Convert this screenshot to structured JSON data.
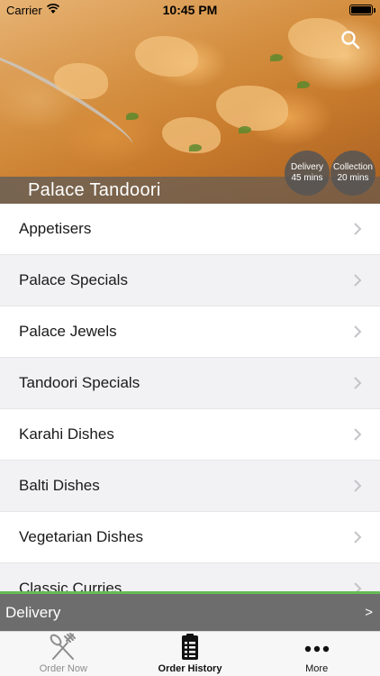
{
  "status_bar": {
    "carrier": "Carrier",
    "time": "10:45 PM",
    "icons": [
      "wifi-icon",
      "battery-icon"
    ]
  },
  "header": {
    "restaurant_name": "Palace Tandoori",
    "search_icon": "search-icon",
    "delivery_badge": {
      "label": "Delivery",
      "time": "45 mins"
    },
    "collection_badge": {
      "label": "Collection",
      "time": "20 mins"
    }
  },
  "menu": {
    "categories": [
      {
        "label": "Appetisers"
      },
      {
        "label": "Palace Specials"
      },
      {
        "label": "Palace Jewels"
      },
      {
        "label": "Tandoori Specials"
      },
      {
        "label": "Karahi Dishes"
      },
      {
        "label": "Balti Dishes"
      },
      {
        "label": "Vegetarian Dishes"
      },
      {
        "label": "Classic Curries"
      }
    ],
    "chevron_icon": "chevron-right-icon"
  },
  "delivery_bar": {
    "label": "Delivery",
    "arrow": ">",
    "accent_color": "#66bb55"
  },
  "tab_bar": {
    "tabs": [
      {
        "label": "Order Now",
        "icon": "fork-knife-icon",
        "active": false
      },
      {
        "label": "Order History",
        "icon": "clipboard-list-icon",
        "active": true
      },
      {
        "label": "More",
        "icon": "more-dots-icon",
        "active": false
      }
    ]
  }
}
